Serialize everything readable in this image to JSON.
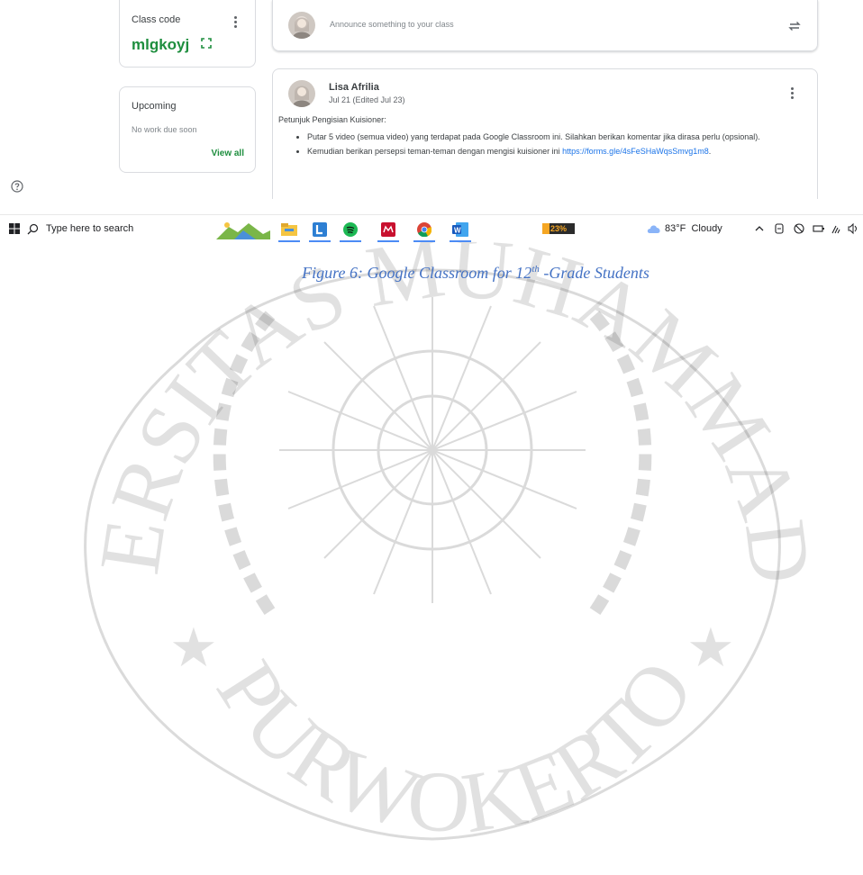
{
  "class_code": {
    "label": "Class code",
    "value": "mlgkoyj"
  },
  "upcoming": {
    "title": "Upcoming",
    "empty_text": "No work due soon",
    "view_all": "View all"
  },
  "announce": {
    "placeholder": "Announce something to your class"
  },
  "post": {
    "author": "Lisa Afrilia",
    "date": "Jul 21 (Edited Jul 23)",
    "intro": "Petunjuk Pengisian Kuisioner:",
    "bullet1": "Putar 5 video (semua video) yang terdapat pada Google Classroom ini. Silahkan berikan komentar jika dirasa perlu (opsional).",
    "bullet2_prefix": "Kemudian berikan persepsi teman-teman dengan mengisi kuisioner ini ",
    "bullet2_link": "https://forms.gle/4sFeSHaWqsSmvg1m8",
    "bullet2_suffix": "."
  },
  "taskbar": {
    "search_placeholder": "Type here to search",
    "battery_percent": "23%",
    "battery_level": 0.23,
    "weather": "83°F  Cloudy",
    "apps": [
      "photos-icon",
      "file-explorer-icon",
      "l-app-icon",
      "spotify-icon",
      "mendeley-icon",
      "chrome-icon",
      "word-icon"
    ]
  },
  "caption": {
    "prefix": "Figure 6: Google Classroom for 12",
    "sup": "th",
    "suffix": " -Grade Students"
  },
  "watermark": {
    "top_text": "UNIVERSITAS MUHAMMADIYAH",
    "bottom_text": "PURWOKERTO"
  },
  "colors": {
    "accent_green": "#1e8e3e",
    "link_blue": "#1a73e8",
    "caption_blue": "#4472c4"
  }
}
